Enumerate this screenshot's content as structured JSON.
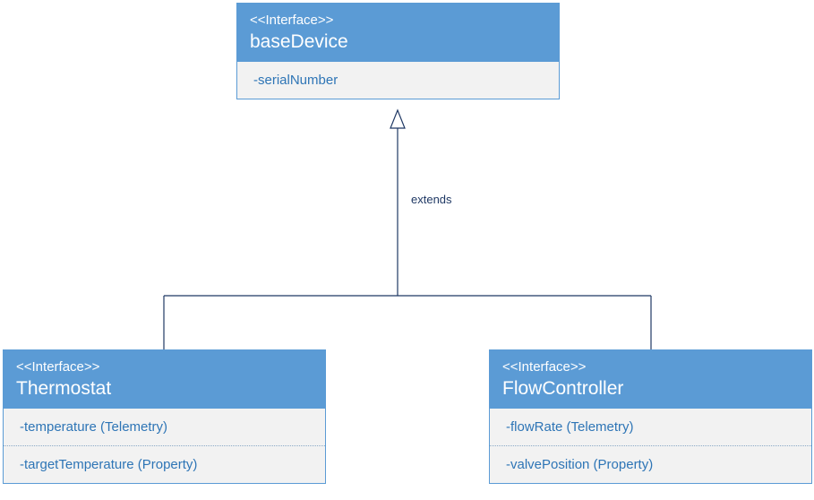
{
  "diagram": {
    "relationship_label": "extends",
    "base": {
      "stereotype": "<<Interface>>",
      "name": "baseDevice",
      "attrs": [
        "-serialNumber"
      ]
    },
    "left": {
      "stereotype": "<<Interface>>",
      "name": "Thermostat",
      "attrs": [
        "-temperature (Telemetry)",
        "-targetTemperature (Property)"
      ]
    },
    "right": {
      "stereotype": "<<Interface>>",
      "name": "FlowController",
      "attrs": [
        "-flowRate (Telemetry)",
        "-valvePosition (Property)"
      ]
    }
  }
}
